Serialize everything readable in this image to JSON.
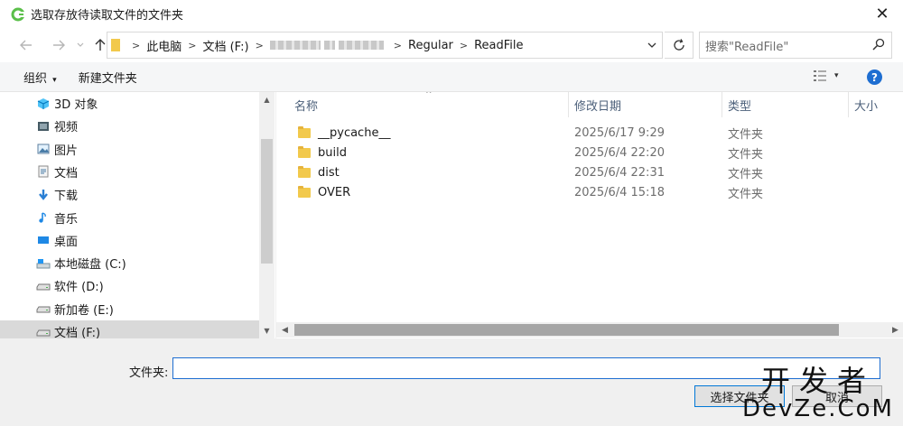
{
  "window": {
    "title": "选取存放待读取文件的文件夹",
    "close_icon": "✕"
  },
  "nav": {
    "back_icon": "arrow-left-icon",
    "forward_icon": "arrow-right-icon",
    "up_icon": "arrow-up-icon",
    "breadcrumbs": [
      "此电脑",
      "文档 (F:)",
      "Regular",
      "ReadFile"
    ],
    "search_placeholder": "搜索\"ReadFile\""
  },
  "toolbar": {
    "organize": "组织",
    "new_folder": "新建文件夹",
    "help": "?"
  },
  "sidebar": {
    "items": [
      {
        "label": "3D 对象",
        "icon": "3d-objects-icon"
      },
      {
        "label": "视频",
        "icon": "video-icon"
      },
      {
        "label": "图片",
        "icon": "pictures-icon"
      },
      {
        "label": "文档",
        "icon": "documents-icon"
      },
      {
        "label": "下载",
        "icon": "download-icon"
      },
      {
        "label": "音乐",
        "icon": "music-icon"
      },
      {
        "label": "桌面",
        "icon": "desktop-icon"
      },
      {
        "label": "本地磁盘 (C:)",
        "icon": "system-drive-icon"
      },
      {
        "label": "软件 (D:)",
        "icon": "drive-icon"
      },
      {
        "label": "新加卷 (E:)",
        "icon": "drive-icon"
      },
      {
        "label": "文档 (F:)",
        "icon": "drive-icon",
        "selected": true
      }
    ]
  },
  "files": {
    "columns": [
      "名称",
      "修改日期",
      "类型",
      "大小"
    ],
    "rows": [
      {
        "name": "__pycache__",
        "date": "2025/6/17 9:29",
        "type": "文件夹"
      },
      {
        "name": "build",
        "date": "2025/6/4 22:20",
        "type": "文件夹"
      },
      {
        "name": "dist",
        "date": "2025/6/4 22:31",
        "type": "文件夹"
      },
      {
        "name": "OVER",
        "date": "2025/6/4 15:18",
        "type": "文件夹"
      }
    ]
  },
  "bottom": {
    "folder_label": "文件夹:",
    "folder_value": "",
    "select_button": "选择文件夹",
    "cancel_button": "取消"
  },
  "watermark": {
    "line1": "开发者",
    "line2": "DevZe.CoM"
  }
}
